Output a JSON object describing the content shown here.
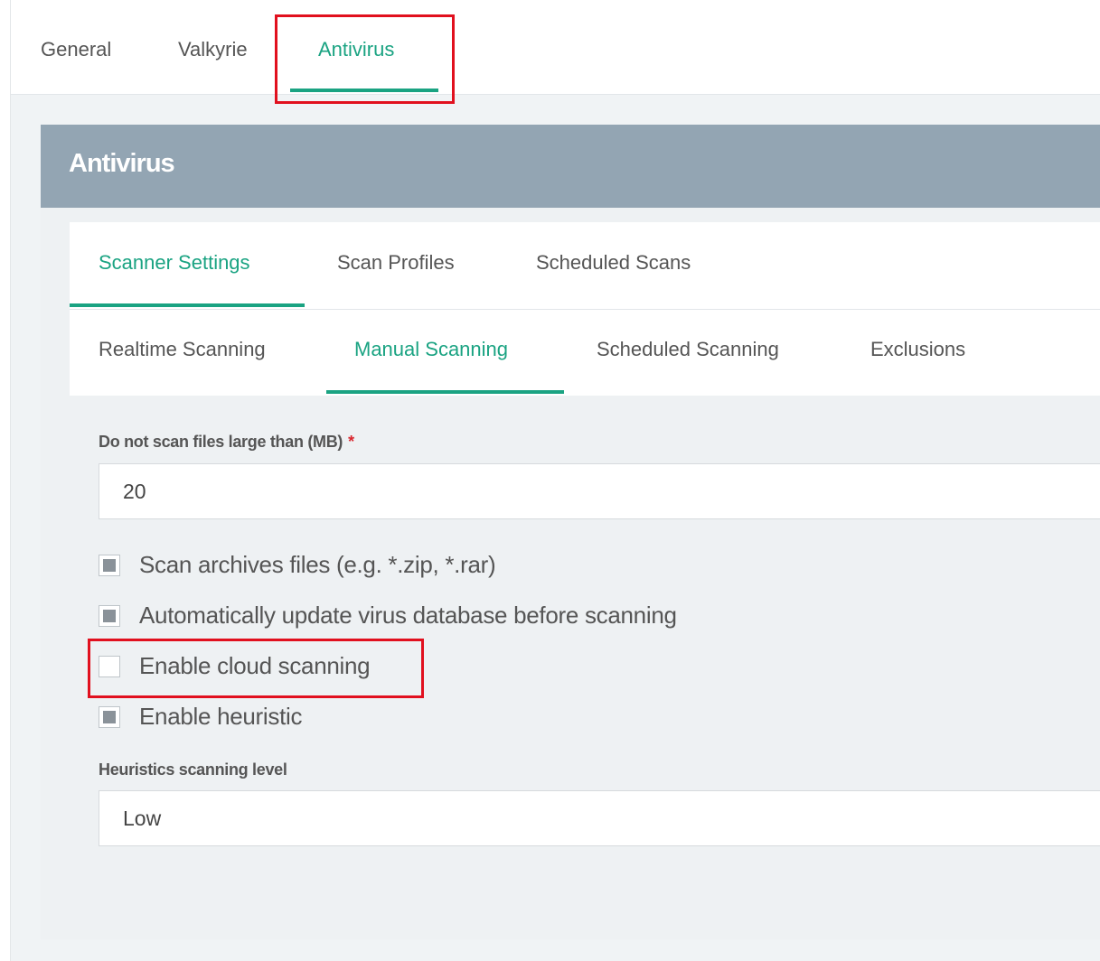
{
  "top_tabs": [
    {
      "label": "General",
      "active": false
    },
    {
      "label": "Valkyrie",
      "active": false
    },
    {
      "label": "Antivirus",
      "active": true
    }
  ],
  "panel": {
    "title": "Antivirus"
  },
  "section_tabs": [
    {
      "label": "Scanner Settings",
      "active": true
    },
    {
      "label": "Scan Profiles",
      "active": false
    },
    {
      "label": "Scheduled Scans",
      "active": false
    }
  ],
  "scan_tabs": [
    {
      "label": "Realtime Scanning",
      "active": false
    },
    {
      "label": "Manual Scanning",
      "active": true
    },
    {
      "label": "Scheduled Scanning",
      "active": false
    },
    {
      "label": "Exclusions",
      "active": false
    }
  ],
  "form": {
    "max_file_size": {
      "label": "Do not scan files large than (MB)",
      "required_mark": "*",
      "value": "20"
    },
    "options": [
      {
        "label": "Scan archives files (e.g. *.zip, *.rar)",
        "checked": true
      },
      {
        "label": "Automatically update virus database before scanning",
        "checked": true
      },
      {
        "label": "Enable cloud scanning",
        "checked": false
      },
      {
        "label": "Enable heuristic",
        "checked": true
      }
    ],
    "heuristics_level": {
      "label": "Heuristics scanning level",
      "value": "Low"
    }
  },
  "colors": {
    "accent": "#1aa382",
    "header_bg": "#93a5b3",
    "highlight": "#e1101e",
    "required": "#d9262e"
  }
}
